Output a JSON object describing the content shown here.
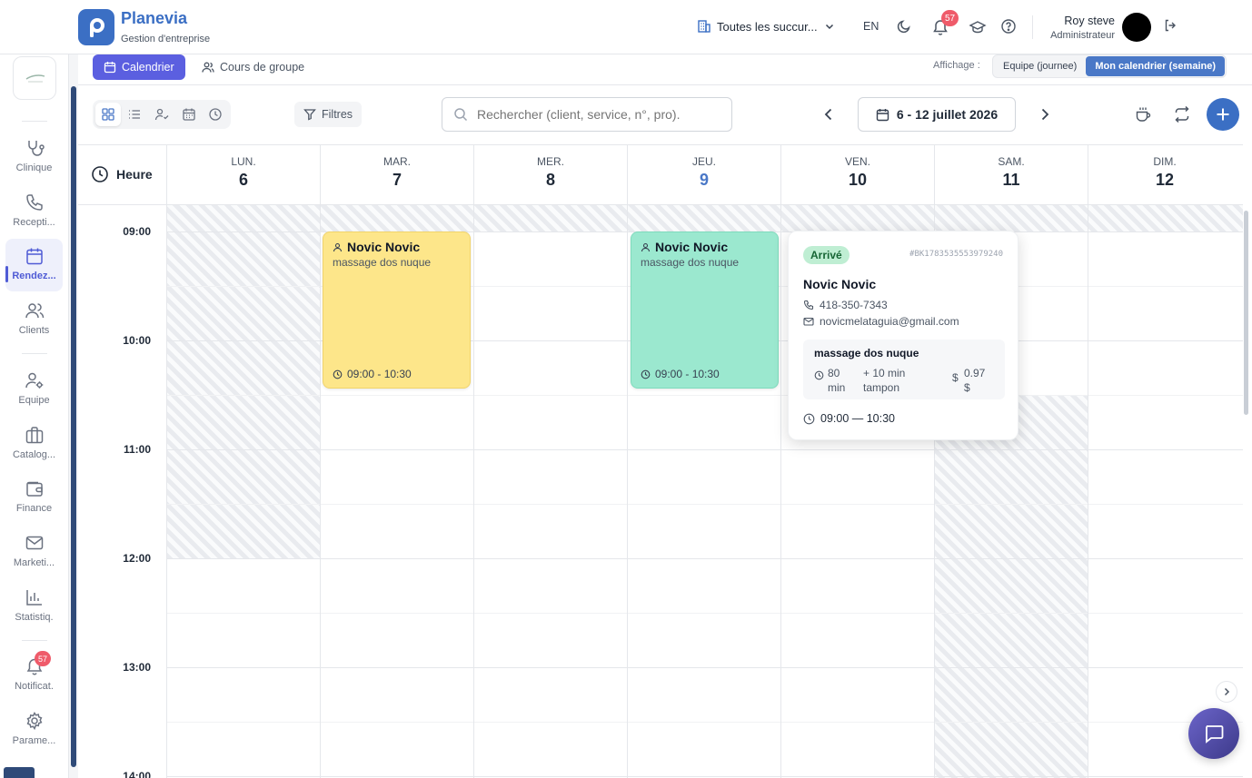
{
  "brand": {
    "name": "Planevia",
    "subtitle": "Gestion d'entreprise"
  },
  "topbar": {
    "branch": "Toutes les succur...",
    "lang": "EN",
    "notif_count": "57",
    "user_name": "Roy steve",
    "user_role": "Administrateur"
  },
  "sidebar": {
    "items": [
      {
        "label": "Clinique",
        "icon": "stethoscope-icon"
      },
      {
        "label": "Recepti...",
        "icon": "phone-icon"
      },
      {
        "label": "Rendez...",
        "icon": "calendar-icon",
        "active": true
      },
      {
        "label": "Clients",
        "icon": "users-icon"
      },
      {
        "label": "Equipe",
        "icon": "user-gear-icon"
      },
      {
        "label": "Catalog...",
        "icon": "briefcase-icon"
      },
      {
        "label": "Finance",
        "icon": "wallet-icon"
      },
      {
        "label": "Marketi...",
        "icon": "mail-icon"
      },
      {
        "label": "Statistiq.",
        "icon": "chart-icon"
      },
      {
        "label": "Notificat.",
        "icon": "bell-icon",
        "badge": "57"
      },
      {
        "label": "Parame...",
        "icon": "gear-icon"
      }
    ]
  },
  "tabs": {
    "calendar": "Calendrier",
    "group": "Cours de groupe"
  },
  "display": {
    "label": "Affichage :",
    "team": "Equipe (journee)",
    "mine": "Mon calendrier (semaine)"
  },
  "toolbar": {
    "filters": "Filtres",
    "search_placeholder": "Rechercher (client, service, n°, pro).",
    "date_range": "6 - 12 juillet 2026"
  },
  "calendar": {
    "hour_label": "Heure",
    "days": [
      {
        "name": "LUN.",
        "num": "6"
      },
      {
        "name": "MAR.",
        "num": "7"
      },
      {
        "name": "MER.",
        "num": "8"
      },
      {
        "name": "JEU.",
        "num": "9",
        "today": true
      },
      {
        "name": "VEN.",
        "num": "10"
      },
      {
        "name": "SAM.",
        "num": "11"
      },
      {
        "name": "DIM.",
        "num": "12"
      }
    ],
    "times": [
      "09:00",
      "10:00",
      "11:00",
      "12:00",
      "13:00",
      "14:00"
    ],
    "events": [
      {
        "name": "Novic Novic",
        "service": "massage dos nuque",
        "time": "09:00 - 10:30",
        "color": "#fde68a"
      },
      {
        "name": "Novic Novic",
        "service": "massage dos nuque",
        "time": "09:00 - 10:30",
        "color": "#9be8cf"
      }
    ]
  },
  "popover": {
    "status": "Arrivé",
    "booking_id": "#BK1783535553979240",
    "client": "Novic Novic",
    "phone": "418-350-7343",
    "email": "novicmelataguia@gmail.com",
    "service": "massage dos nuque",
    "duration_value": "80",
    "duration_unit": "min",
    "buffer_value": "+ 10 min",
    "buffer_unit": "tampon",
    "price_value": "0.97",
    "price_unit": "$",
    "time_range": "09:00 — 10:30"
  }
}
